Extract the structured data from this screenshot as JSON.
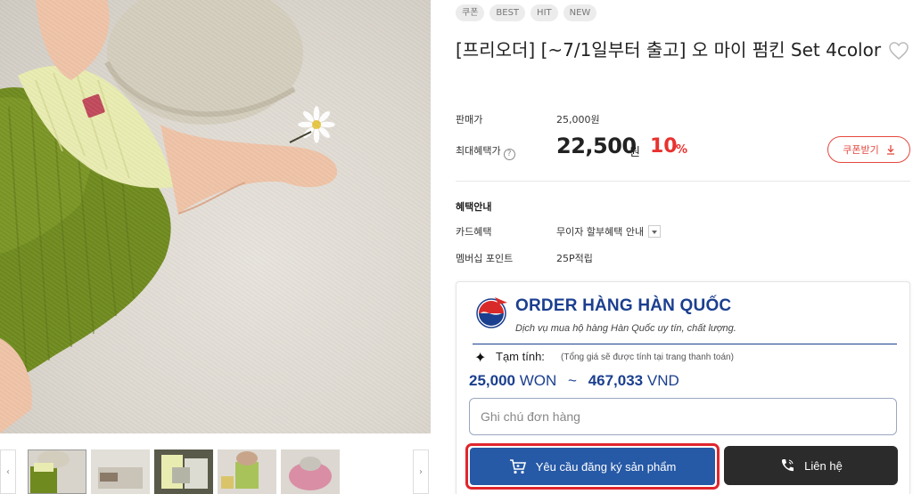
{
  "product": {
    "badges": [
      "쿠폰",
      "BEST",
      "HIT",
      "NEW"
    ],
    "title": "[프리오더] [~7/1일부터 출고] 오 마이 펌킨 Set 4color"
  },
  "pricing": {
    "sale_label": "판매가",
    "sale_value": "25,000원",
    "max_benefit_label": "최대혜택가",
    "max_benefit_value": "22,500",
    "max_benefit_unit": "원",
    "discount_number": "10",
    "discount_symbol": "%",
    "coupon_button": "쿠폰받기"
  },
  "benefits": {
    "section_title": "혜택안내",
    "card_label": "카드혜택",
    "card_value": "무이자 할부혜택 안내",
    "member_label": "멤버십 포인트",
    "member_value": "25P적립"
  },
  "order": {
    "brand_name": "ORDER HÀNG HÀN QUỐC",
    "brand_tagline": "Dịch vụ mua hộ hàng Hàn Quốc uy tín, chất lượng.",
    "estimate_label": "Tạm tính:",
    "estimate_note": "(Tổng giá sẽ được tính tại trang thanh toán)",
    "price_won": "25,000",
    "unit_won": "WON",
    "tilde": "~",
    "price_vnd": "467,033",
    "unit_vnd": "VND",
    "note_placeholder": "Ghi chú đơn hàng",
    "request_button": "Yêu cầu đăng ký sản phẩm",
    "contact_button": "Liên hệ"
  },
  "colors": {
    "accent_red": "#e8322f",
    "brand_blue": "#1b3f8f",
    "button_blue": "#2659a6",
    "highlight_red": "#e0262d",
    "dark_button": "#2b2b2b"
  },
  "icons": [
    "heart-icon",
    "question-icon",
    "download-icon",
    "dropdown-icon",
    "sparkle-icon",
    "cart-icon",
    "phone-icon",
    "chevron-left-icon",
    "chevron-right-icon"
  ]
}
